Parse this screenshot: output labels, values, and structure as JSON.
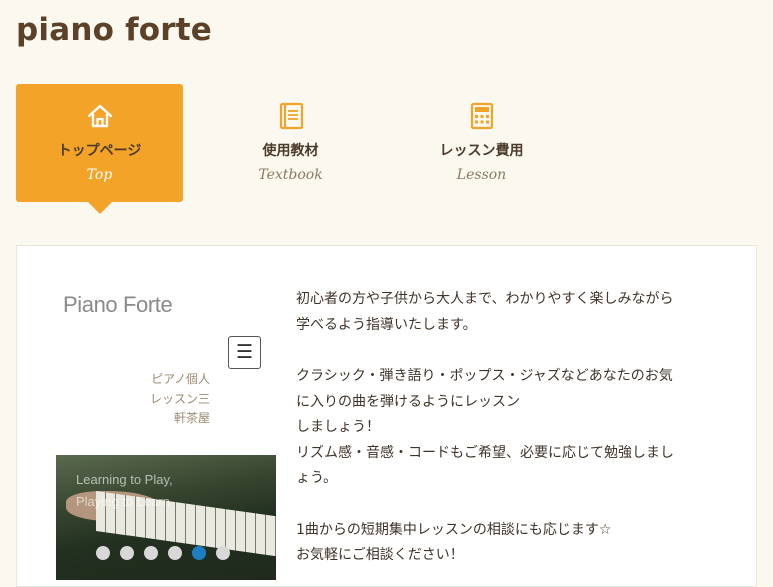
{
  "site": {
    "title": "piano forte"
  },
  "nav": {
    "items": [
      {
        "label": "トップページ",
        "sub": "Top",
        "icon": "home-icon",
        "active": true
      },
      {
        "label": "使用教材",
        "sub": "Textbook",
        "icon": "book-icon",
        "active": false
      },
      {
        "label": "レッスン費用",
        "sub": "Lesson",
        "icon": "calculator-icon",
        "active": false
      }
    ]
  },
  "colors": {
    "accent": "#f2a328",
    "background": "#fbf8ef",
    "active_dot": "#1d7fc2"
  },
  "preview": {
    "title": "Piano Forte",
    "menu_icon": "hamburger-icon",
    "subtitle": "ピアノ個人レッスン三軒茶屋",
    "slider_caption_1": "Learning to Play,",
    "slider_caption_2": "Playing to Learn",
    "dots_count": 6,
    "active_dot_index": 4
  },
  "description": {
    "p1_line1": "初心者の方や子供から大人まで、わかりやすく楽しみながら",
    "p1_line2": "学べるよう指導いたします。",
    "p2_line1": "クラシック・弾き語り・ポップス・ジャズなどあなたのお気",
    "p2_line2": "に入りの曲を弾けるようにレッスン",
    "p2_line3": "しましょう！",
    "p2_line4": "リズム感・音感・コードもご希望、必要に応じて勉強しまし",
    "p2_line5": "ょう。",
    "p3_line1": "1曲からの短期集中レッスンの相談にも応じます☆",
    "p3_line2": "お気軽にご相談ください！"
  }
}
